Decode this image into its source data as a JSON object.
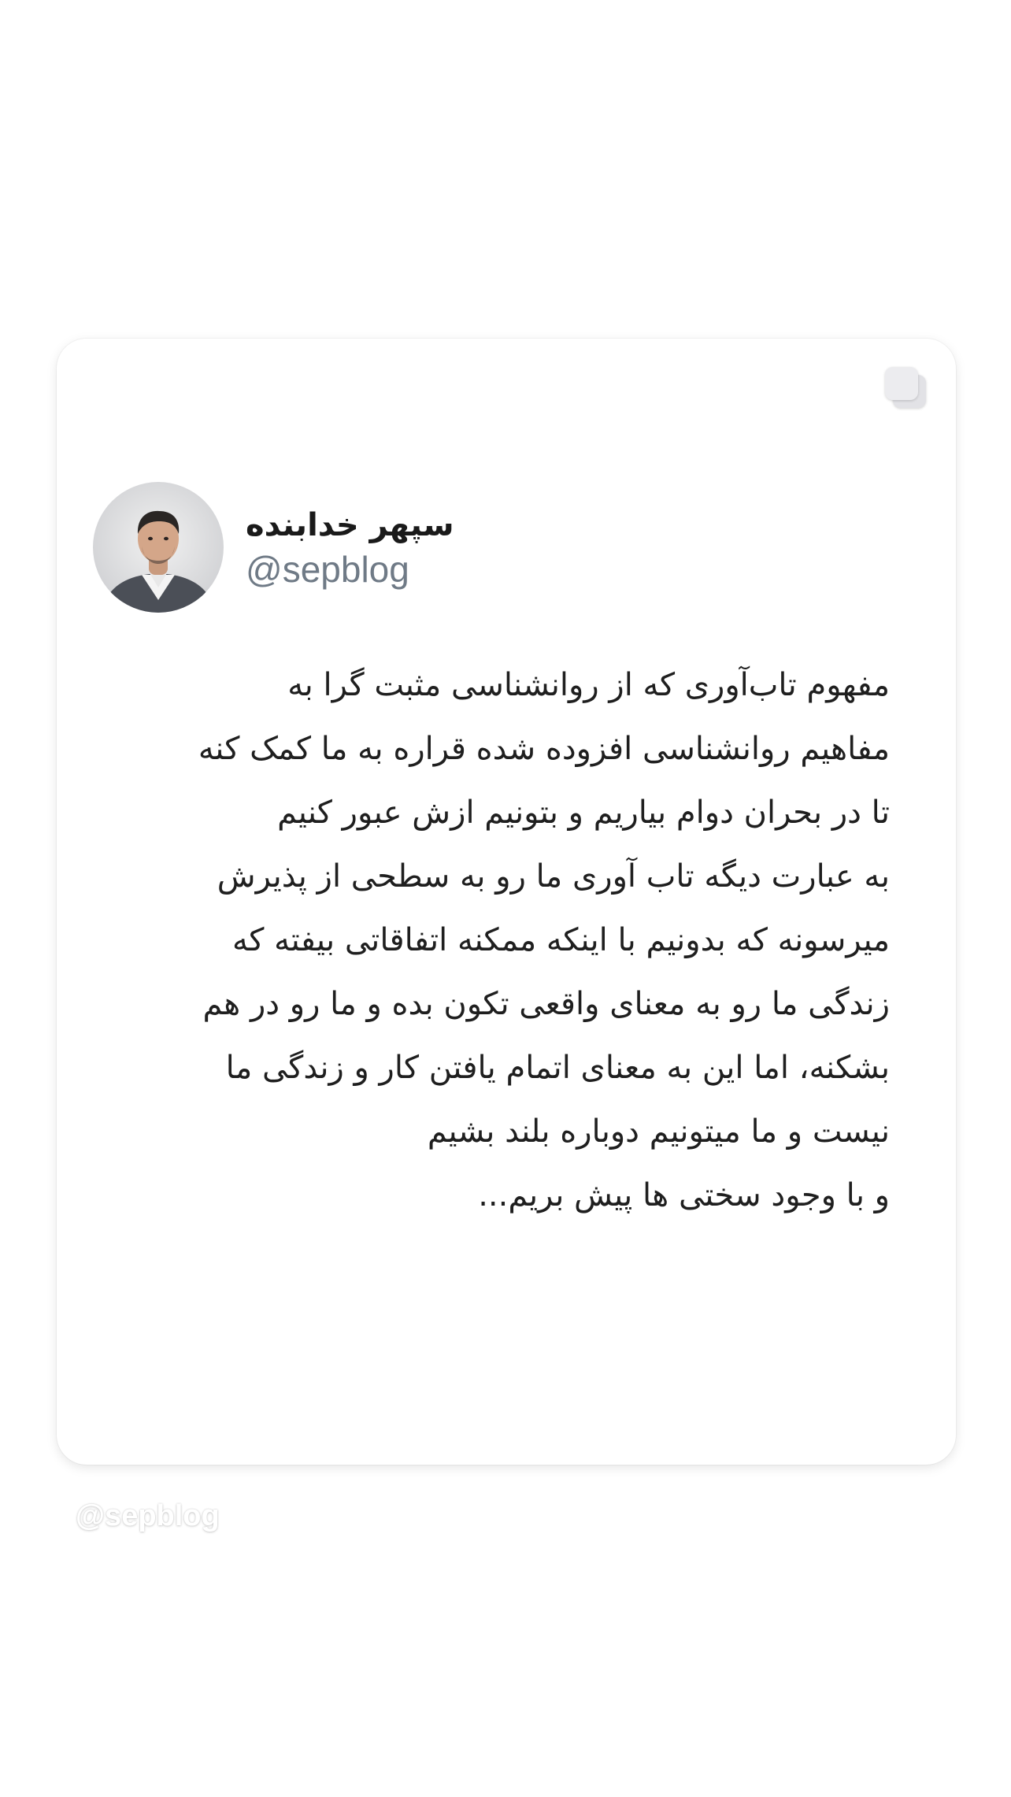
{
  "profile": {
    "display_name": "سپهر خدابنده",
    "handle": "@sepblog",
    "avatar_icon": "user-photo-avatar"
  },
  "tweet": {
    "lines": [
      "مفهوم تاب‌آوری که از روانشناسی مثبت گرا به",
      "مفاهیم روانشناسی افزوده شده قراره به ما کمک کنه",
      "تا در بحران دوام بیاریم و بتونیم ازش عبور کنیم",
      "به عبارت دیگه تاب آوری ما رو به سطحی از پذیرش",
      "میرسونه که بدونیم با اینکه ممکنه اتفاقاتی بیفته که",
      "زندگی ما رو به معنای واقعی تکون بده و ما رو در هم",
      "بشکنه، اما این به معنای اتمام یافتن کار و زندگی ما",
      "نیست و ما میتونیم دوباره بلند بشیم",
      "و با وجود سختی ها پیش بریم..."
    ]
  },
  "copy_icon": "copy-icon",
  "watermark": "@sepblog",
  "colors": {
    "background": "#ffffff",
    "card": "#ffffff",
    "text": "#1f1f1f",
    "handle": "#6f7a86"
  }
}
